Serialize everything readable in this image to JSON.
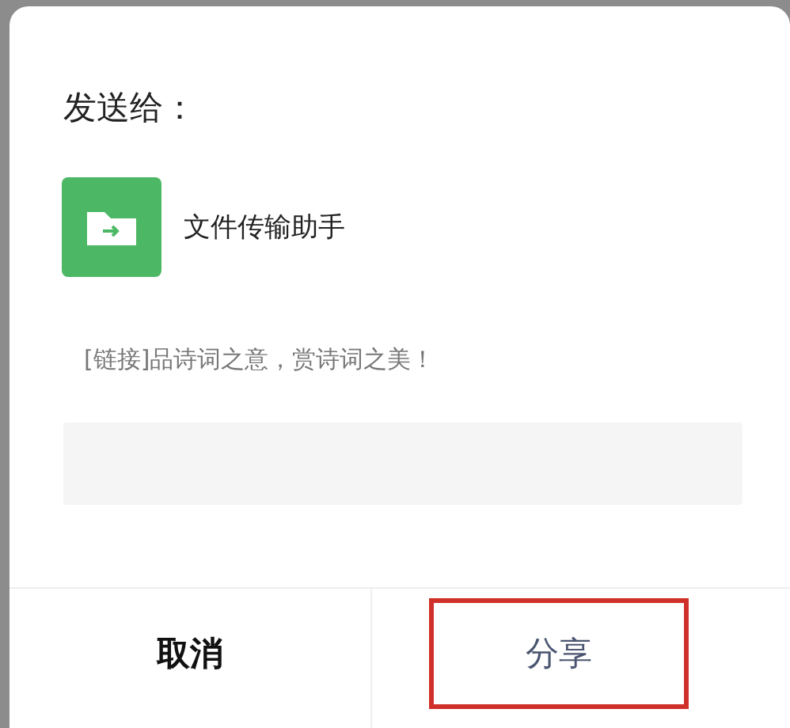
{
  "dialog": {
    "title": "发送给：",
    "recipient": {
      "name": "文件传输助手"
    },
    "shared_link": "[链接]品诗词之意，赏诗词之美！",
    "message_field": {
      "kind": "input"
    },
    "buttons": [
      {
        "label": "取消",
        "kind": "cancel",
        "highlighted": false
      },
      {
        "label": "分享",
        "kind": "confirm",
        "highlighted": true
      }
    ]
  }
}
